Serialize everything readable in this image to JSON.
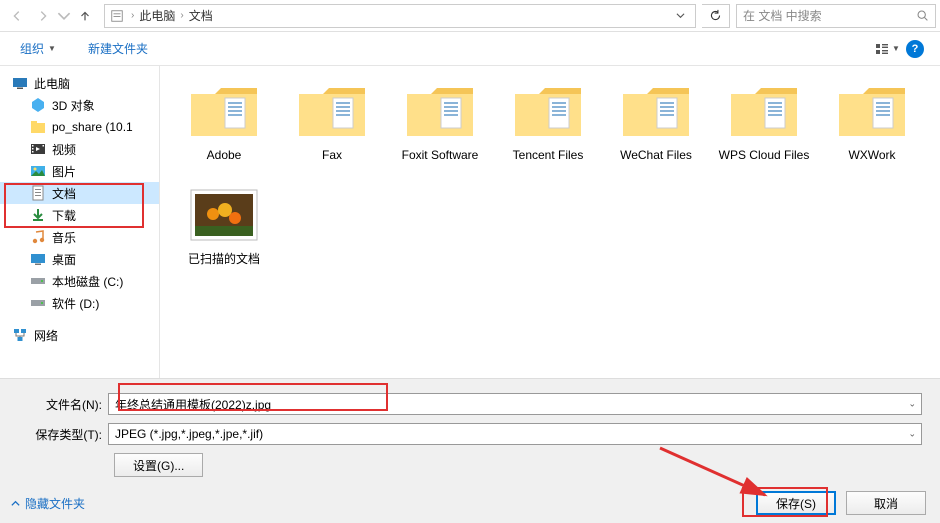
{
  "nav": {
    "path_root": "此电脑",
    "path_current": "文档",
    "search_placeholder": "在 文档 中搜索"
  },
  "toolbar": {
    "organize": "组织",
    "new_folder": "新建文件夹"
  },
  "sidebar": {
    "this_pc": "此电脑",
    "items": [
      "3D 对象",
      "po_share (10.1",
      "视频",
      "图片",
      "文档",
      "下载",
      "音乐",
      "桌面",
      "本地磁盘 (C:)",
      "软件 (D:)"
    ],
    "network": "网络"
  },
  "folders": [
    "Adobe",
    "Fax",
    "Foxit Software",
    "Tencent Files",
    "WeChat Files",
    "WPS Cloud Files",
    "WXWork",
    "已扫描的文档"
  ],
  "form": {
    "filename_label": "文件名(N):",
    "filename_value": "年终总结通用模板(2022)z.jpg",
    "type_label": "保存类型(T):",
    "type_value": "JPEG (*.jpg,*.jpeg,*.jpe,*.jif)",
    "settings": "设置(G)..."
  },
  "footer": {
    "hide_folders": "隐藏文件夹",
    "save": "保存(S)",
    "cancel": "取消"
  }
}
